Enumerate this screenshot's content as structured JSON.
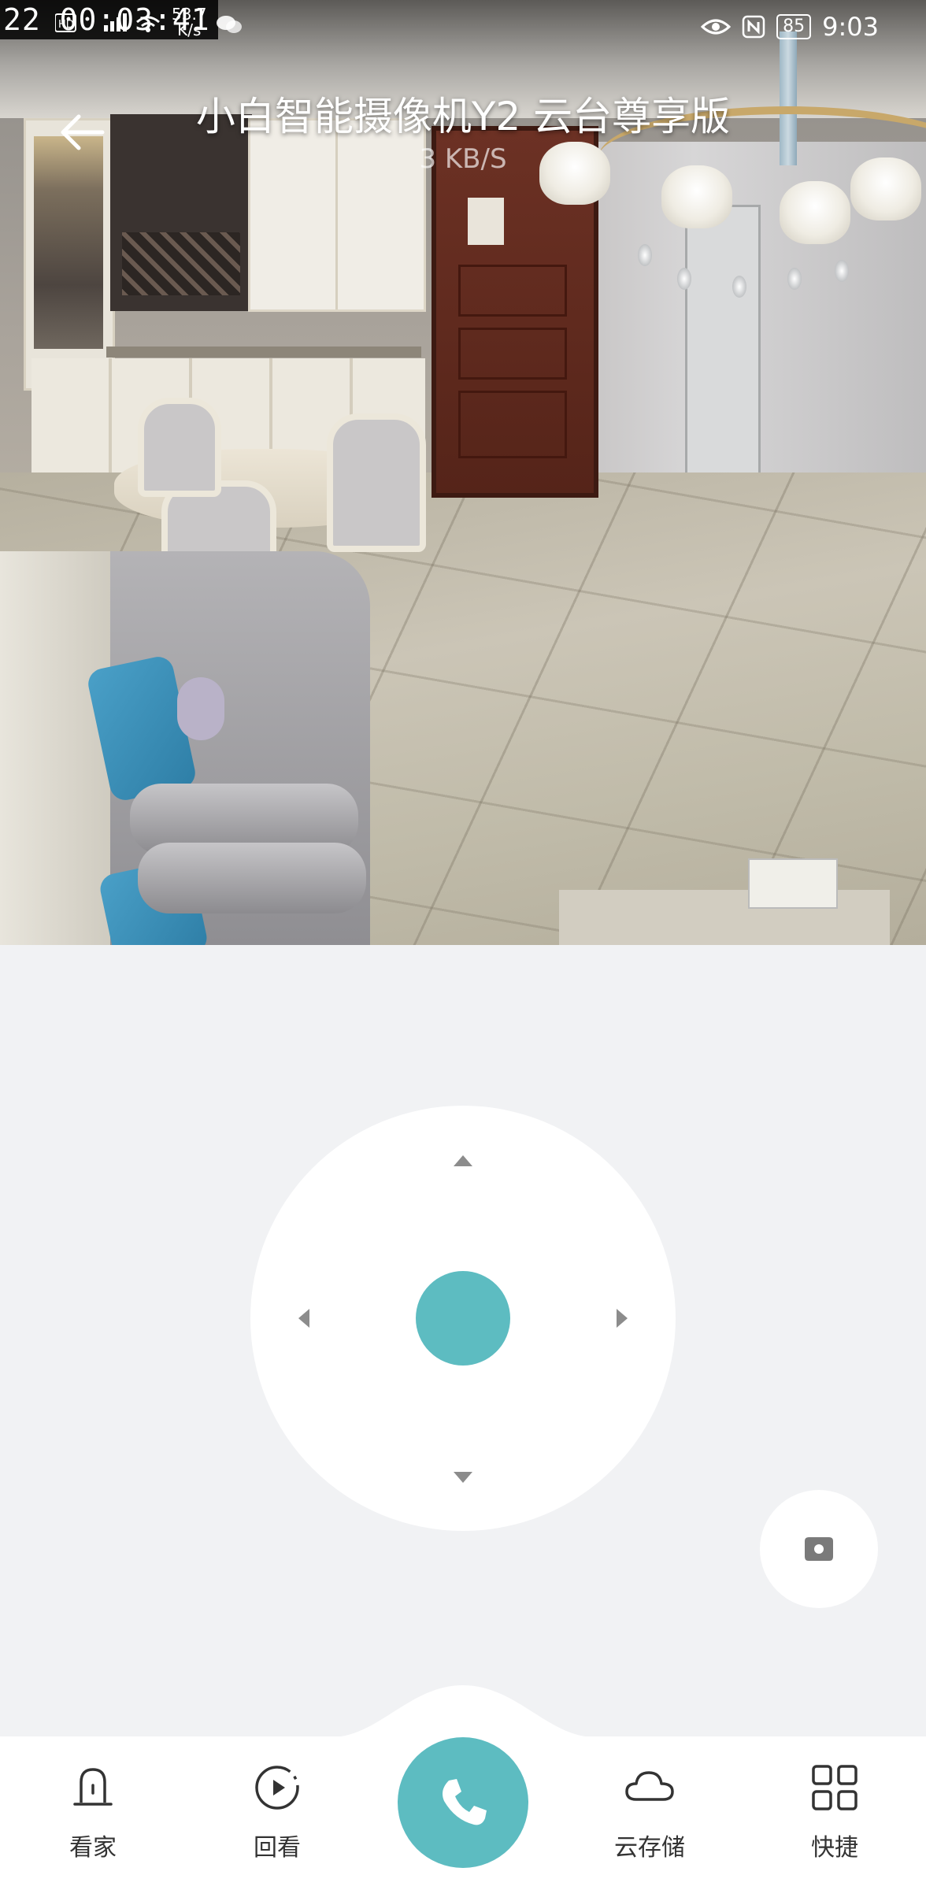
{
  "status_bar": {
    "timestamp": "22 00:03:41",
    "network_speed_value": "53.7",
    "network_speed_unit": "K/s",
    "battery": "85",
    "time": "9:03"
  },
  "header": {
    "title": "小白智能摄像机Y2 云台尊享版",
    "bitrate": "3 KB/S"
  },
  "colors": {
    "accent": "#5dbcc1",
    "background": "#f1f2f4",
    "arrow": "#8c8c8c"
  },
  "ptz": {
    "up_icon": "arrow-up-icon",
    "down_icon": "arrow-down-icon",
    "left_icon": "arrow-left-icon",
    "right_icon": "arrow-right-icon"
  },
  "bottom_nav": {
    "items": [
      {
        "label": "看家",
        "icon": "alarm-light-icon"
      },
      {
        "label": "回看",
        "icon": "playback-icon"
      },
      {
        "label": "云存储",
        "icon": "cloud-icon"
      },
      {
        "label": "快捷",
        "icon": "grid-icon"
      }
    ],
    "call_icon": "phone-icon"
  }
}
